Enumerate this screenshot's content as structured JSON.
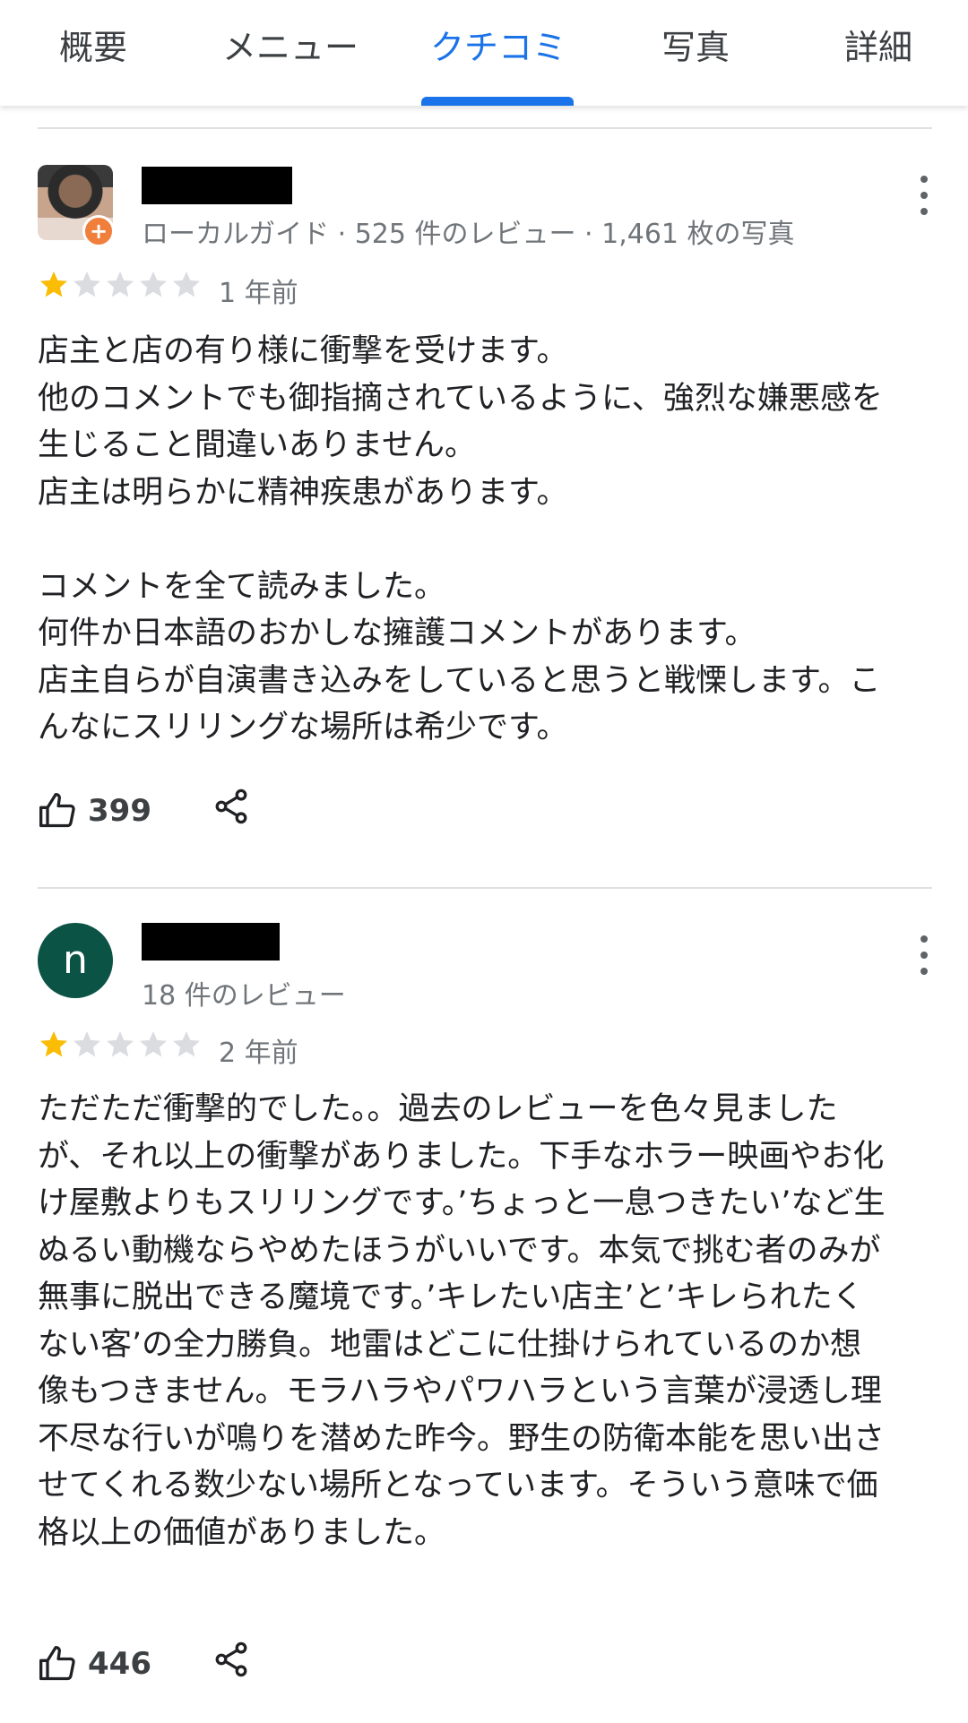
{
  "tabs": [
    {
      "label": "概要",
      "active": false
    },
    {
      "label": "メニュー",
      "active": false
    },
    {
      "label": "クチコミ",
      "active": true
    },
    {
      "label": "写真",
      "active": false
    },
    {
      "label": "詳細",
      "active": false
    }
  ],
  "colors": {
    "accent": "#1a73e8",
    "star_filled": "#fbbc04",
    "star_empty": "#dadce0",
    "avatar_n": "#0b5345",
    "guide_badge": "#f07f3c"
  },
  "reviews": [
    {
      "author_redacted": true,
      "avatar": "photo",
      "local_guide_badge": true,
      "meta": "ローカルガイド · 525 件のレビュー · 1,461 枚の写真",
      "rating": 1,
      "max_rating": 5,
      "date": "1 年前",
      "text": "店主と店の有り様に衝撃を受けます。\n他のコメントでも御指摘されているように、強烈な嫌悪感を生じること間違いありません。\n店主は明らかに精神疾患があります。\n\nコメントを全て読みました。\n何件か日本語のおかしな擁護コメントがあります。\n店主自らが自演書き込みをしていると思うと戦慄します。こんなにスリリングな場所は希少です。",
      "likes": "399",
      "icons": {
        "like": "thumbs-up-icon",
        "share": "share-icon",
        "more": "more-vert-icon"
      }
    },
    {
      "author_redacted": true,
      "avatar": "letter",
      "avatar_letter": "n",
      "local_guide_badge": false,
      "meta": "18 件のレビュー",
      "rating": 1,
      "max_rating": 5,
      "date": "2 年前",
      "text": "ただただ衝撃的でした。。過去のレビューを色々見ましたが、それ以上の衝撃がありました。下手なホラー映画やお化け屋敷よりもスリリングです。’ちょっと一息つきたい’など生ぬるい動機ならやめたほうがいいです。本気で挑む者のみが無事に脱出できる魔境です。’キレたい店主’と’キレられたくない客’の全力勝負。地雷はどこに仕掛けられているのか想像もつきません。モラハラやパワハラという言葉が浸透し理不尽な行いが鳴りを潜めた昨今。野生の防衛本能を思い出させてくれる数少ない場所となっています。そういう意味で価格以上の価値がありました。",
      "likes": "446",
      "icons": {
        "like": "thumbs-up-icon",
        "share": "share-icon",
        "more": "more-vert-icon"
      }
    }
  ]
}
